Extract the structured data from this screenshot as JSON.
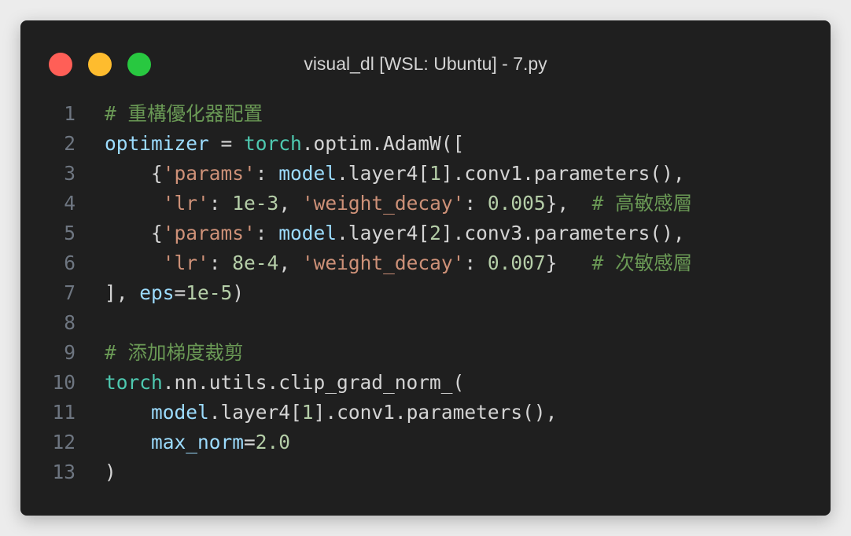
{
  "window": {
    "title": "visual_dl [WSL: Ubuntu] - 7.py",
    "buttons": [
      {
        "name": "close",
        "color": "#ff5f57"
      },
      {
        "name": "minimize",
        "color": "#febc2e"
      },
      {
        "name": "maximize",
        "color": "#28c840"
      }
    ]
  },
  "code": {
    "lines": [
      {
        "n": "1",
        "tokens": [
          {
            "t": "# 重構優化器配置",
            "k": "comment"
          }
        ]
      },
      {
        "n": "2",
        "tokens": [
          {
            "t": "optimizer",
            "k": "var"
          },
          {
            "t": " = ",
            "k": "punct"
          },
          {
            "t": "torch",
            "k": "module"
          },
          {
            "t": ".optim.AdamW([",
            "k": "func"
          }
        ]
      },
      {
        "n": "3",
        "tokens": [
          {
            "t": "    {",
            "k": "punct"
          },
          {
            "t": "'params'",
            "k": "string"
          },
          {
            "t": ": ",
            "k": "punct"
          },
          {
            "t": "model",
            "k": "var"
          },
          {
            "t": ".layer4[",
            "k": "func"
          },
          {
            "t": "1",
            "k": "number"
          },
          {
            "t": "].conv1.parameters(),",
            "k": "func"
          }
        ]
      },
      {
        "n": "4",
        "tokens": [
          {
            "t": "     ",
            "k": "punct"
          },
          {
            "t": "'lr'",
            "k": "string"
          },
          {
            "t": ": ",
            "k": "punct"
          },
          {
            "t": "1e-3",
            "k": "number"
          },
          {
            "t": ", ",
            "k": "punct"
          },
          {
            "t": "'weight_decay'",
            "k": "string"
          },
          {
            "t": ": ",
            "k": "punct"
          },
          {
            "t": "0.005",
            "k": "number"
          },
          {
            "t": "},  ",
            "k": "punct"
          },
          {
            "t": "# 高敏感層",
            "k": "comment"
          }
        ]
      },
      {
        "n": "5",
        "tokens": [
          {
            "t": "    {",
            "k": "punct"
          },
          {
            "t": "'params'",
            "k": "string"
          },
          {
            "t": ": ",
            "k": "punct"
          },
          {
            "t": "model",
            "k": "var"
          },
          {
            "t": ".layer4[",
            "k": "func"
          },
          {
            "t": "2",
            "k": "number"
          },
          {
            "t": "].conv3.parameters(),",
            "k": "func"
          }
        ]
      },
      {
        "n": "6",
        "tokens": [
          {
            "t": "     ",
            "k": "punct"
          },
          {
            "t": "'lr'",
            "k": "string"
          },
          {
            "t": ": ",
            "k": "punct"
          },
          {
            "t": "8e-4",
            "k": "number"
          },
          {
            "t": ", ",
            "k": "punct"
          },
          {
            "t": "'weight_decay'",
            "k": "string"
          },
          {
            "t": ": ",
            "k": "punct"
          },
          {
            "t": "0.007",
            "k": "number"
          },
          {
            "t": "}   ",
            "k": "punct"
          },
          {
            "t": "# 次敏感層",
            "k": "comment"
          }
        ]
      },
      {
        "n": "7",
        "tokens": [
          {
            "t": "], ",
            "k": "punct"
          },
          {
            "t": "eps",
            "k": "var"
          },
          {
            "t": "=",
            "k": "punct"
          },
          {
            "t": "1e-5",
            "k": "number"
          },
          {
            "t": ")",
            "k": "punct"
          }
        ]
      },
      {
        "n": "8",
        "tokens": []
      },
      {
        "n": "9",
        "tokens": [
          {
            "t": "# 添加梯度裁剪",
            "k": "comment"
          }
        ]
      },
      {
        "n": "10",
        "tokens": [
          {
            "t": "torch",
            "k": "module"
          },
          {
            "t": ".nn.utils.clip_grad_norm_(",
            "k": "func"
          }
        ]
      },
      {
        "n": "11",
        "tokens": [
          {
            "t": "    ",
            "k": "punct"
          },
          {
            "t": "model",
            "k": "var"
          },
          {
            "t": ".layer4[",
            "k": "func"
          },
          {
            "t": "1",
            "k": "number"
          },
          {
            "t": "].conv1.parameters(),",
            "k": "func"
          }
        ]
      },
      {
        "n": "12",
        "tokens": [
          {
            "t": "    ",
            "k": "punct"
          },
          {
            "t": "max_norm",
            "k": "var"
          },
          {
            "t": "=",
            "k": "punct"
          },
          {
            "t": "2.0",
            "k": "number"
          }
        ]
      },
      {
        "n": "13",
        "tokens": [
          {
            "t": ")",
            "k": "punct"
          }
        ]
      }
    ]
  }
}
